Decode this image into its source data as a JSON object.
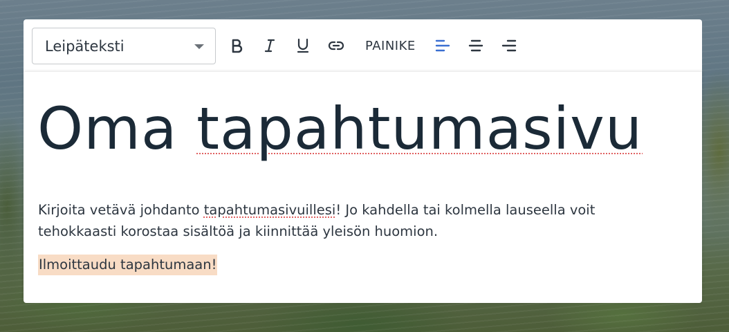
{
  "toolbar": {
    "text_style": "Leipäteksti",
    "buttons": [
      {
        "name": "bold",
        "icon": "bold-icon"
      },
      {
        "name": "italic",
        "icon": "italic-icon"
      },
      {
        "name": "underline",
        "icon": "underline-icon"
      },
      {
        "name": "link",
        "icon": "link-icon"
      }
    ],
    "button_label": "PAINIKE",
    "alignment": {
      "options": [
        "align-left-icon",
        "align-center-icon",
        "align-right-icon"
      ],
      "active": "left",
      "active_color": "#3a6fd1"
    }
  },
  "editor": {
    "heading_part1": "Oma ",
    "heading_part2": "tapahtumasivu",
    "intro_part1": "Kirjoita vetävä johdanto ",
    "intro_flagged": "tapahtumasivuillesi",
    "intro_part2": "! Jo kahdella tai kolmella lauseella voit tehokkaasti korostaa sisältöä ja kiinnittää yleisön huomion.",
    "cta_text": "Ilmoittaudu tapahtumaan!",
    "cta_highlight_color": "#f8dcc5"
  }
}
